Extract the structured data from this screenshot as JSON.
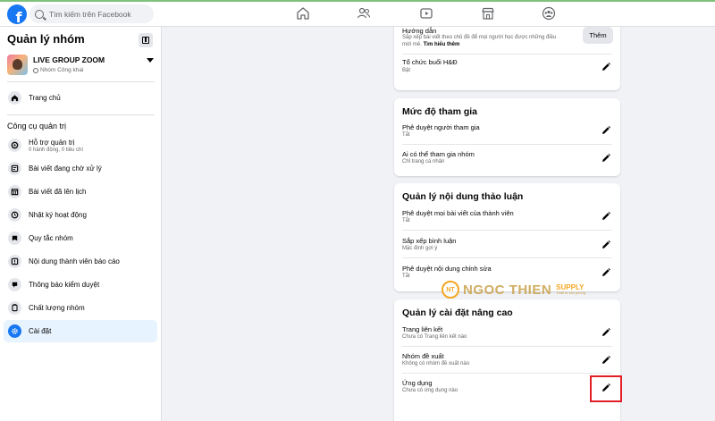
{
  "topbar": {
    "logo_letter": "f",
    "search_placeholder": "Tìm kiếm trên Facebook",
    "nav_icons": [
      "home-icon",
      "friends-icon",
      "watch-icon",
      "marketplace-icon",
      "groups-icon"
    ]
  },
  "sidebar": {
    "title": "Quản lý nhóm",
    "group": {
      "name": "LIVE GROUP ZOOM",
      "privacy": "Nhóm Công khai"
    },
    "home_label": "Trang chủ",
    "section_label": "Công cụ quản trị",
    "items": [
      {
        "label": "Hỗ trợ quản trị",
        "sub": "0 hành động, 0 tiêu chí",
        "icon": "admin-assist-icon"
      },
      {
        "label": "Bài viết đang chờ xử lý",
        "icon": "pending-posts-icon"
      },
      {
        "label": "Bài viết đã lên lịch",
        "icon": "scheduled-posts-icon"
      },
      {
        "label": "Nhật ký hoạt động",
        "icon": "activity-log-icon"
      },
      {
        "label": "Quy tắc nhóm",
        "icon": "group-rules-icon"
      },
      {
        "label": "Nội dung thành viên báo cáo",
        "icon": "reported-content-icon"
      },
      {
        "label": "Thông báo kiểm duyệt",
        "icon": "moderation-alerts-icon"
      },
      {
        "label": "Chất lượng nhóm",
        "icon": "group-quality-icon"
      },
      {
        "label": "Cài đặt",
        "icon": "settings-icon",
        "active": true
      }
    ]
  },
  "cards": {
    "top": {
      "guide_label": "Hướng dẫn",
      "guide_sub_1": "Sắp xếp bài viết theo chủ đề để mọi người học được những điều",
      "guide_sub_2": "mới mẻ.",
      "guide_link": "Tìm hiểu thêm",
      "add_button": "Thêm",
      "hd_label": "Tổ chức buổi H&Đ",
      "hd_sub": "Bật"
    },
    "participation": {
      "title": "Mức độ tham gia",
      "rows": [
        {
          "label": "Phê duyệt người tham gia",
          "sub": "Tắt"
        },
        {
          "label": "Ai có thể tham gia nhóm",
          "sub": "Chỉ trang cá nhân"
        }
      ]
    },
    "discussion": {
      "title": "Quản lý nội dung thảo luận",
      "rows": [
        {
          "label": "Phê duyệt mọi bài viết của thành viên",
          "sub": "Tắt"
        },
        {
          "label": "Sắp xếp bình luận",
          "sub": "Mặc định gợi ý"
        },
        {
          "label": "Phê duyệt nội dung chỉnh sửa",
          "sub": "Tắt"
        }
      ]
    },
    "advanced": {
      "title": "Quản lý cài đặt nâng cao",
      "rows": [
        {
          "label": "Trang liên kết",
          "sub": "Chưa có Trang liên kết nào"
        },
        {
          "label": "Nhóm đề xuất",
          "sub": "Không có nhóm đề xuất nào"
        },
        {
          "label": "Ứng dụng",
          "sub": "Chưa có ứng dụng nào"
        }
      ]
    }
  },
  "watermark": {
    "badge": "NT",
    "text": "NGOC THIEN",
    "supply": "SUPPLY",
    "tagline": "Thiết bị văn phòng"
  },
  "colors": {
    "brand": "#1877f2",
    "highlight": "#e21f26"
  }
}
